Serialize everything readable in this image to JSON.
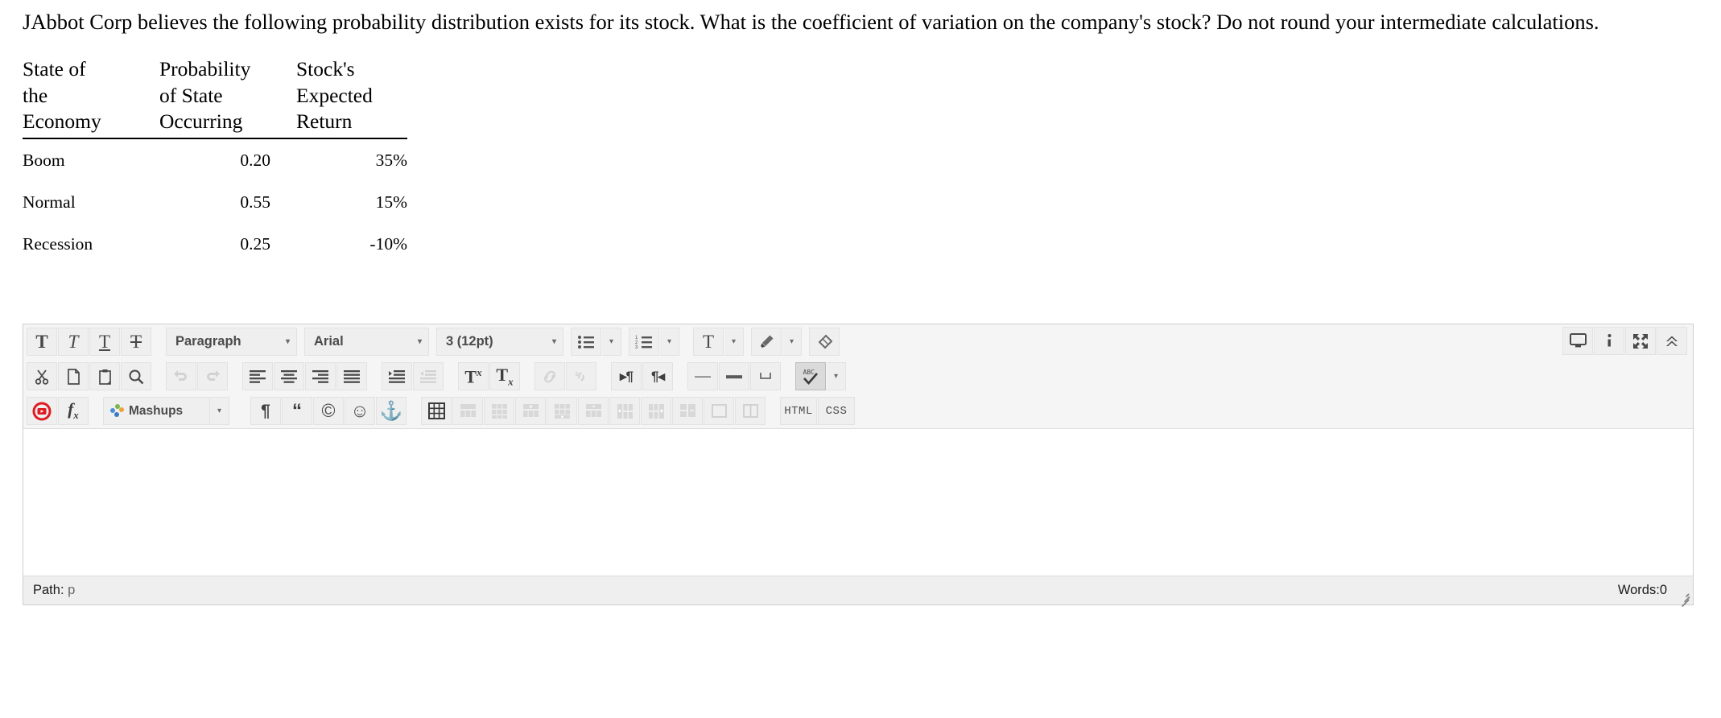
{
  "question": {
    "text": "JAbbot Corp believes the following probability distribution exists for its stock. What is the coefficient of variation on the company's stock? Do not round your intermediate calculations."
  },
  "table": {
    "headers": [
      {
        "lines": [
          "State of",
          "the",
          "Economy"
        ]
      },
      {
        "lines": [
          "Probability",
          "of State",
          "Occurring"
        ]
      },
      {
        "lines": [
          "Stock's",
          "Expected",
          "Return"
        ]
      }
    ],
    "rows": [
      {
        "state": "Boom",
        "probability": "0.20",
        "return": "35%"
      },
      {
        "state": "Normal",
        "probability": "0.55",
        "return": "15%"
      },
      {
        "state": "Recession",
        "probability": "0.25",
        "return": "-10%"
      }
    ]
  },
  "editor": {
    "toolbar": {
      "row1": {
        "bold_label": "T",
        "italic_label": "T",
        "underline_label": "T",
        "strikethrough_label": "T",
        "paragraph_select": "Paragraph",
        "font_select": "Arial",
        "size_select": "3 (12pt)",
        "text_color_label": "T",
        "caret": "▾"
      },
      "row2": {
        "superscript_label": "T",
        "superscript_sup": "x",
        "subscript_label": "T",
        "subscript_sub": "x",
        "ltr_label": "▸¶",
        "rtl_label": "¶◂",
        "spellcheck_label": "ABC",
        "caret": "▾"
      },
      "row3": {
        "mashups_label": "Mashups",
        "math_label": "f",
        "math_sub": "x",
        "pilcrow_label": "¶",
        "quote_label": "“",
        "copyright_label": "©",
        "smiley_label": "☺",
        "anchor_label": "⚓",
        "html_label": "HTML",
        "css_label": "CSS",
        "caret": "▾"
      },
      "right": {
        "preview_label": "preview",
        "info_label": "i",
        "fullscreen_label": "fullscreen",
        "collapse_label": "collapse"
      }
    },
    "content": "",
    "status": {
      "path_label": "Path:",
      "path_value": "p",
      "words_label": "Words:0"
    }
  },
  "colors": {
    "toolbar_bg": "#f5f5f5",
    "button_bg": "#efefef",
    "border": "#cfcfcf",
    "text": "#4b4b4b",
    "record_red": "#e01b22"
  }
}
